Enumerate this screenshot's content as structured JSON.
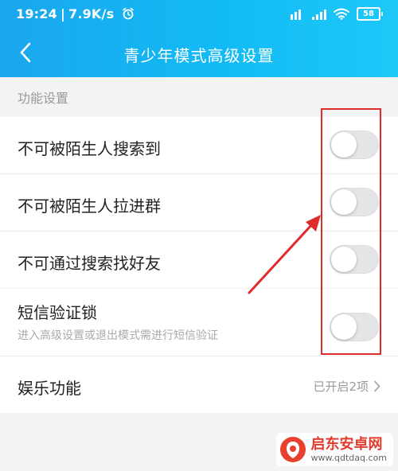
{
  "status_bar": {
    "time": "19:24",
    "speed": "7.9K/s",
    "battery": "58",
    "alarm_icon": "alarm-clock-icon",
    "signal_icon": "signal-bars-icon",
    "wifi_icon": "wifi-icon"
  },
  "nav": {
    "title": "青少年模式高级设置",
    "back_icon": "chevron-left-icon"
  },
  "section": {
    "label": "功能设置"
  },
  "settings": {
    "search_by_stranger": {
      "label": "不可被陌生人搜索到",
      "enabled": false
    },
    "pulled_into_group": {
      "label": "不可被陌生人拉进群",
      "enabled": false
    },
    "find_friends": {
      "label": "不可通过搜索找好友",
      "enabled": false
    },
    "sms_lock": {
      "label": "短信验证锁",
      "description": "进入高级设置或退出模式需进行短信验证",
      "enabled": false
    },
    "entertainment": {
      "label": "娱乐功能",
      "value": "已开启2项",
      "chevron_icon": "chevron-right-icon"
    }
  },
  "watermark": {
    "name": "启东安卓网",
    "url": "www.qdtdaq.com"
  },
  "colors": {
    "header_gradient_start": "#1aa6ee",
    "header_gradient_end": "#1ec8f8",
    "annotation_red": "#e02b2b",
    "toggle_off": "#e4e5e7"
  }
}
